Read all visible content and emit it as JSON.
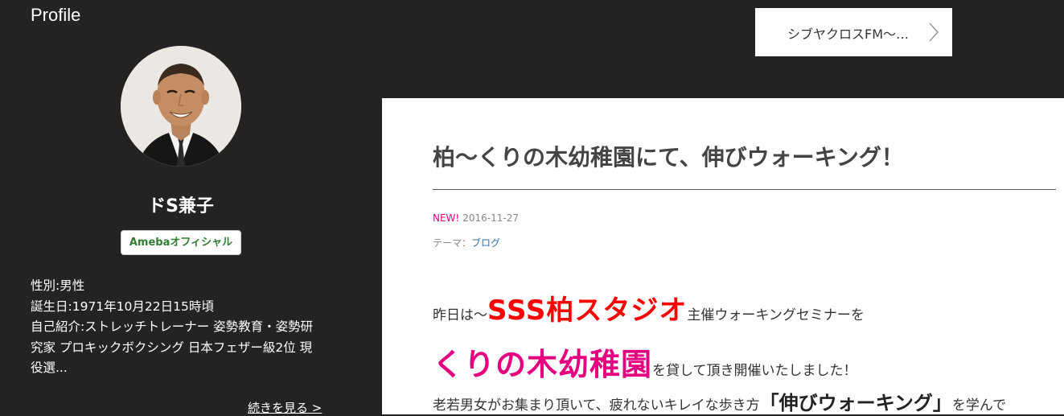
{
  "sidebar": {
    "heading": "Profile",
    "name": "ドS兼子",
    "badge": "Amebaオフィシャル",
    "info": [
      "性別:男性",
      "誕生日:1971年10月22日15時頃",
      "自己紹介:ストレッチトレーナー 姿勢教育・姿勢研",
      "究家 プロキックボクシング 日本フェザー級2位 現",
      "役選..."
    ],
    "read_more": "続きを見る >"
  },
  "nav": {
    "next_entry_label": "シブヤクロスFM〜…",
    "icon": "chevron-right-icon"
  },
  "article": {
    "title": "柏〜くりの木幼稚園にて、伸びウォーキング！",
    "new_label": "NEW!",
    "date": "2016-11-27",
    "theme_label": "テーマ：",
    "theme_link": "ブログ",
    "line1": {
      "prefix": "昨日は〜",
      "highlight": "SSS柏スタジオ",
      "suffix": "主催ウォーキングセミナーを"
    },
    "line2": {
      "highlight": "くりの木幼稚園",
      "suffix": "を貸して頂き開催いたしました！"
    },
    "line3": {
      "prefix": "老若男女がお集まり頂いて、疲れないキレイな歩き方",
      "highlight": "「伸びウォーキング」",
      "suffix": "を学んで"
    }
  },
  "colors": {
    "page_background": "#232323",
    "article_background": "#ffffff",
    "highlight_red": "#ff0000",
    "highlight_pink": "#e4007f",
    "badge_green": "#2e7d32",
    "link_blue": "#2a6fb0"
  }
}
